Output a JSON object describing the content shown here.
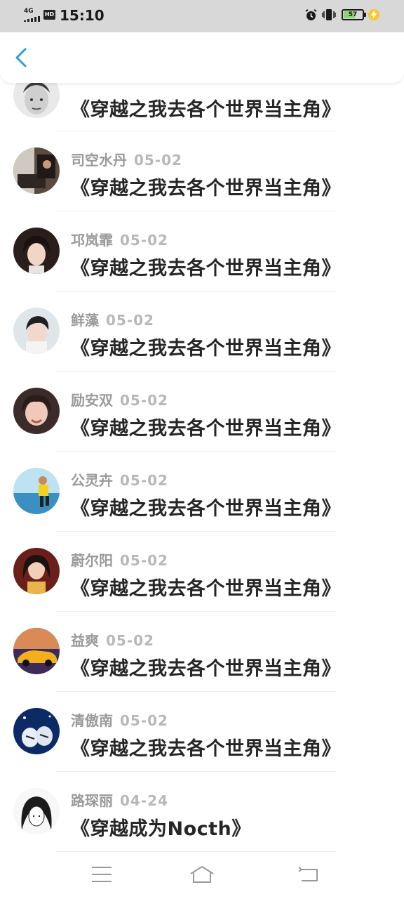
{
  "status_bar": {
    "network": "4G",
    "hd": "HD",
    "time": "15:10",
    "battery_level": "57",
    "icons": [
      "alarm-icon",
      "vibrate-icon",
      "battery-icon",
      "charging-icon"
    ]
  },
  "header": {
    "back_icon": "chevron-left-icon",
    "accent_color": "#2d9cdb"
  },
  "items": [
    {
      "name": "",
      "date": "",
      "title": "《穿越之我去各个世界当主角》"
    },
    {
      "name": "司空水丹",
      "date": "05-02",
      "title": "《穿越之我去各个世界当主角》"
    },
    {
      "name": "邛岚霏",
      "date": "05-02",
      "title": "《穿越之我去各个世界当主角》"
    },
    {
      "name": "鲜藻",
      "date": "05-02",
      "title": "《穿越之我去各个世界当主角》"
    },
    {
      "name": "励安双",
      "date": "05-02",
      "title": "《穿越之我去各个世界当主角》"
    },
    {
      "name": "公灵卉",
      "date": "05-02",
      "title": "《穿越之我去各个世界当主角》"
    },
    {
      "name": "蔚尔阳",
      "date": "05-02",
      "title": "《穿越之我去各个世界当主角》"
    },
    {
      "name": "益爽",
      "date": "05-02",
      "title": "《穿越之我去各个世界当主角》"
    },
    {
      "name": "清傲南",
      "date": "05-02",
      "title": "《穿越之我去各个世界当主角》"
    },
    {
      "name": "路琛丽",
      "date": "04-24",
      "title": "《穿越成为Nocth》"
    }
  ],
  "bottom_nav": [
    "menu-icon",
    "home-icon",
    "back-icon"
  ]
}
